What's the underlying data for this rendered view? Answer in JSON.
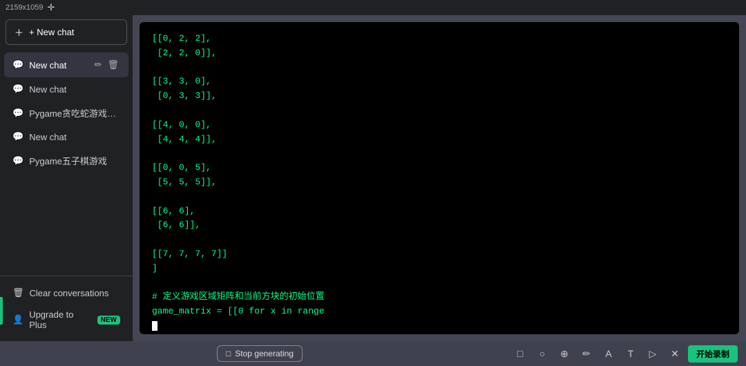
{
  "topbar": {
    "title": "2159x1059",
    "icon": "✛"
  },
  "sidebar": {
    "new_chat_button": "+ New chat",
    "items": [
      {
        "id": "chat1",
        "label": "New chat",
        "active": true
      },
      {
        "id": "chat2",
        "label": "New chat",
        "active": false
      },
      {
        "id": "chat3",
        "label": "Pygame贪吃蛇游戏代码",
        "active": false
      },
      {
        "id": "chat4",
        "label": "New chat",
        "active": false
      },
      {
        "id": "chat5",
        "label": "Pygame五子棋游戏",
        "active": false
      }
    ],
    "bottom": [
      {
        "id": "clear",
        "label": "Clear conversations",
        "icon": "🗑"
      },
      {
        "id": "upgrade",
        "label": "Upgrade to Plus",
        "icon": "👤",
        "badge": "NEW"
      }
    ]
  },
  "code": {
    "lines": [
      "[[0, 2, 2],",
      " [2, 2, 0]],",
      "",
      "[[3, 3, 0],",
      " [0, 3, 3]],",
      "",
      "[[4, 0, 0],",
      " [4, 4, 4]],",
      "",
      "[[0, 0, 5],",
      " [5, 5, 5]],",
      "",
      "[[6, 6],",
      " [6, 6]],",
      "",
      "[[7, 7, 7, 7]]",
      "]",
      "",
      "# 定义游戏区域矩阵和当前方块的初始位置",
      "game_matrix = [[0 for x in range"
    ],
    "cursor": true
  },
  "bottom_bar": {
    "stop_btn": "Stop generating",
    "toolbar_icons": [
      "□",
      "○",
      "⚲",
      "✏",
      "A",
      "T",
      "▷",
      "✕"
    ],
    "start_btn": "开始录制"
  }
}
